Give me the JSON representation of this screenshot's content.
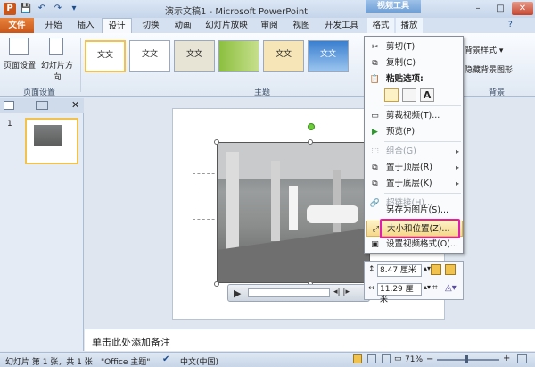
{
  "titlebar": {
    "app_title": "演示文稿1 - Microsoft PowerPoint",
    "context_group": "视频工具",
    "minimize": "–",
    "maximize": "□",
    "close": "✕"
  },
  "qat": {
    "save": "💾",
    "undo": "↶",
    "redo": "↷",
    "more": "▾"
  },
  "tabs": [
    "文件",
    "开始",
    "插入",
    "设计",
    "切换",
    "动画",
    "幻灯片放映",
    "审阅",
    "视图",
    "开发工具",
    "格式",
    "播放"
  ],
  "ribbon": {
    "page_setup": "页面设置",
    "orientation": "幻灯片方向",
    "group_page_setup": "页面设置",
    "group_theme": "主题",
    "group_background": "背景",
    "theme_label": "文文",
    "background_styles": "背景样式",
    "hide_background": "隐藏背景图形"
  },
  "left_panel": {
    "slide_number": "1"
  },
  "notes": {
    "placeholder": "单击此处添加备注"
  },
  "status": {
    "slide_info": "幻灯片 第 1 张，共 1 张",
    "theme": "\"Office 主题\"",
    "language": "中文(中国)",
    "zoom": "71%"
  },
  "context_menu": {
    "cut": "剪切(T)",
    "copy": "复制(C)",
    "paste_options": "粘贴选项:",
    "trim_video": "剪裁视频(T)...",
    "preview": "预览(P)",
    "group": "组合(G)",
    "bring_front": "置于顶层(R)",
    "send_back": "置于底层(K)",
    "hyperlink": "超链接(H)...",
    "save_as_picture": "另存为图片(S)...",
    "size_position": "大小和位置(Z)...",
    "format_video": "设置视频格式(O)..."
  },
  "mini_toolbar": {
    "height": "8.47 厘米",
    "width": "11.29 厘米"
  }
}
